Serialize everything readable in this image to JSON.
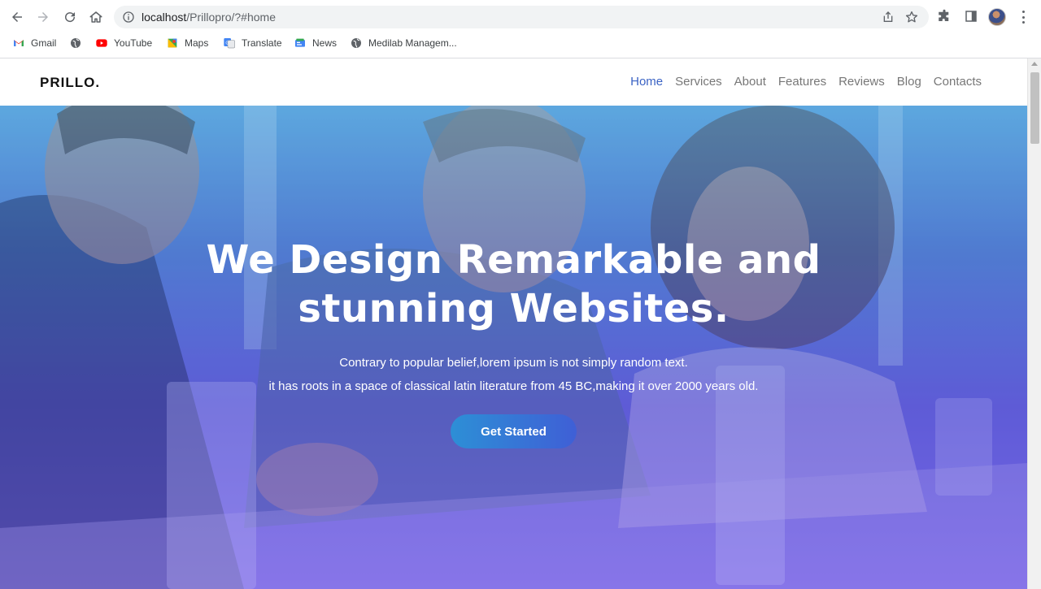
{
  "browser": {
    "url_host": "localhost",
    "url_path": "/Prillopro/?#home",
    "icons": {
      "back": "arrow-left-icon",
      "forward": "arrow-right-icon",
      "reload": "reload-icon",
      "home": "home-icon",
      "info": "info-icon",
      "share": "share-icon",
      "bookmark": "star-icon",
      "extensions": "puzzle-icon",
      "side_panel": "side-panel-icon",
      "profile": "avatar",
      "menu": "kebab-menu-icon"
    },
    "bookmarks": [
      {
        "label": "Gmail",
        "icon": "gmail-icon"
      },
      {
        "label": "",
        "icon": "globe-icon"
      },
      {
        "label": "YouTube",
        "icon": "youtube-icon"
      },
      {
        "label": "Maps",
        "icon": "maps-icon"
      },
      {
        "label": "Translate",
        "icon": "translate-icon"
      },
      {
        "label": "News",
        "icon": "news-icon"
      },
      {
        "label": "Medilab Managem...",
        "icon": "globe-icon"
      }
    ]
  },
  "site": {
    "brand": "PRILLO.",
    "nav": [
      {
        "label": "Home",
        "active": true
      },
      {
        "label": "Services",
        "active": false
      },
      {
        "label": "About",
        "active": false
      },
      {
        "label": "Features",
        "active": false
      },
      {
        "label": "Reviews",
        "active": false
      },
      {
        "label": "Blog",
        "active": false
      },
      {
        "label": "Contacts",
        "active": false
      }
    ],
    "colors": {
      "accent": "#3b63c4",
      "nav_text": "#777777",
      "hero_top": "#5aa9e0",
      "hero_bottom": "#7a59ea",
      "cta_start": "#2d8fd6",
      "cta_end": "#3f5fd6"
    }
  },
  "hero": {
    "title_line1": "We Design Remarkable and",
    "title_line2": "stunning Websites.",
    "subtitle_line1": "Contrary to popular belief,lorem ipsum is not simply random text.",
    "subtitle_line2": "it has roots in a space of classical latin literature from 45 BC,making it over 2000 years old.",
    "cta_label": "Get Started"
  }
}
